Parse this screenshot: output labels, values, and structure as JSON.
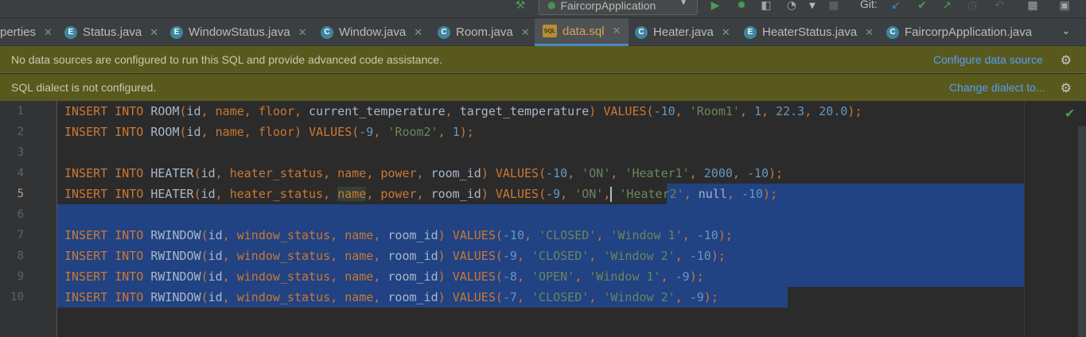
{
  "toolbar": {
    "run_config": "FaircorpApplication",
    "git_label": "Git:",
    "colors": {
      "run": "#499c54",
      "debug": "#499c54",
      "vcs_update": "#3d87c9",
      "vcs_commit": "#499c54"
    }
  },
  "tabs": [
    {
      "label": "perties",
      "icon": "none"
    },
    {
      "label": "Status.java",
      "icon": "E"
    },
    {
      "label": "WindowStatus.java",
      "icon": "E"
    },
    {
      "label": "Window.java",
      "icon": "C"
    },
    {
      "label": "Room.java",
      "icon": "C"
    },
    {
      "label": "data.sql",
      "icon": "SQL",
      "active": true
    },
    {
      "label": "Heater.java",
      "icon": "C"
    },
    {
      "label": "HeaterStatus.java",
      "icon": "E"
    },
    {
      "label": "FaircorpApplication.java",
      "icon": "C"
    }
  ],
  "banners": {
    "datasource_message": "No data sources are configured to run this SQL and provide advanced code assistance.",
    "datasource_link": "Configure data source",
    "dialect_message": "SQL dialect is not configured.",
    "dialect_link": "Change dialect to..."
  },
  "editor": {
    "line_numbers": [
      "1",
      "2",
      "3",
      "4",
      "5",
      "6",
      "7",
      "8",
      "9",
      "10"
    ],
    "current_line": 5,
    "lines": [
      "INSERT INTO ROOM(id, name, floor, current_temperature, target_temperature) VALUES(-10, 'Room1', 1, 22.3, 20.0);",
      "INSERT INTO ROOM(id, name, floor) VALUES(-9, 'Room2', 1);",
      "",
      "INSERT INTO HEATER(id, heater_status, name, power, room_id) VALUES(-10, 'ON', 'Heater1', 2000, -10);",
      "INSERT INTO HEATER(id, heater_status, name, power, room_id) VALUES(-9, 'ON', 'Heater2', null, -10);",
      "",
      "INSERT INTO RWINDOW(id, window_status, name, room_id) VALUES(-10, 'CLOSED', 'Window 1', -10);",
      "INSERT INTO RWINDOW(id, window_status, name, room_id) VALUES(-9, 'CLOSED', 'Window 2', -10);",
      "INSERT INTO RWINDOW(id, window_status, name, room_id) VALUES(-8, 'OPEN', 'Window 1', -9);",
      "INSERT INTO RWINDOW(id, window_status, name, room_id) VALUES(-7, 'CLOSED', 'Window 2', -9);"
    ],
    "colors": {
      "keyword": "#cc7832",
      "string": "#6a8759",
      "number": "#6897bb",
      "text": "#a9b7c6",
      "selection": "#214283"
    }
  }
}
